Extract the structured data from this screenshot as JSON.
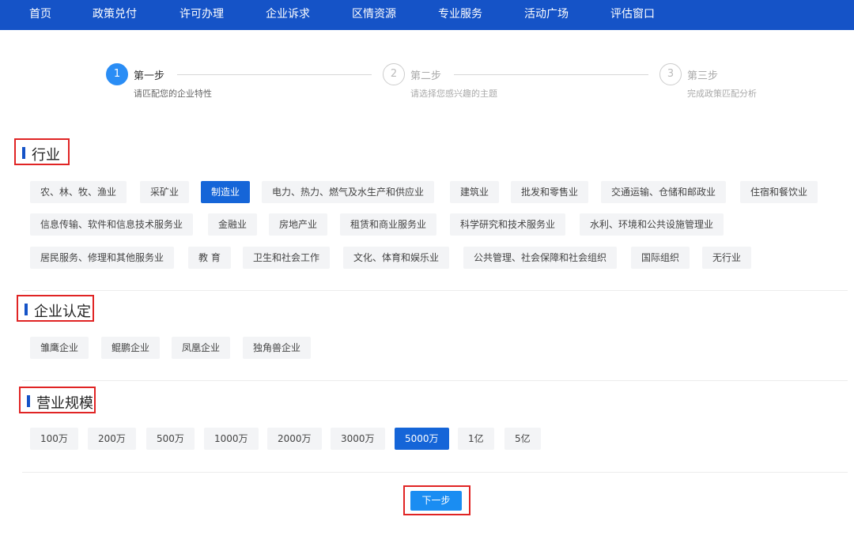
{
  "nav": {
    "items": [
      "首页",
      "政策兑付",
      "许可办理",
      "企业诉求",
      "区情资源",
      "专业服务",
      "活动广场",
      "评估窗口"
    ]
  },
  "steps": [
    {
      "num": "1",
      "title": "第一步",
      "desc": "请匹配您的企业特性",
      "state": "active"
    },
    {
      "num": "2",
      "title": "第二步",
      "desc": "请选择您感兴趣的主题",
      "state": "idle"
    },
    {
      "num": "3",
      "title": "第三步",
      "desc": "完成政策匹配分析",
      "state": "idle"
    }
  ],
  "industry": {
    "title": "行业",
    "rows": [
      [
        "农、林、牧、渔业",
        "采矿业",
        "制造业",
        "电力、热力、燃气及水生产和供应业",
        "建筑业",
        "批发和零售业",
        "交通运输、仓储和邮政业",
        "住宿和餐饮业"
      ],
      [
        "信息传输、软件和信息技术服务业",
        "金融业",
        "房地产业",
        "租赁和商业服务业",
        "科学研究和技术服务业",
        "水利、环境和公共设施管理业"
      ],
      [
        "居民服务、修理和其他服务业",
        "教 育",
        "卫生和社会工作",
        "文化、体育和娱乐业",
        "公共管理、社会保障和社会组织",
        "国际组织",
        "无行业"
      ]
    ],
    "selected": "制造业"
  },
  "certification": {
    "title": "企业认定",
    "items": [
      "雏鹰企业",
      "鲲鹏企业",
      "凤凰企业",
      "独角兽企业"
    ]
  },
  "scale": {
    "title": "营业规模",
    "items": [
      "100万",
      "200万",
      "500万",
      "1000万",
      "2000万",
      "3000万",
      "5000万",
      "1亿",
      "5亿"
    ],
    "selected": "5000万"
  },
  "next_label": "下一步",
  "colors": {
    "nav_bg": "#1553c7",
    "selected": "#1565d8",
    "highlight_box": "#e02424"
  }
}
